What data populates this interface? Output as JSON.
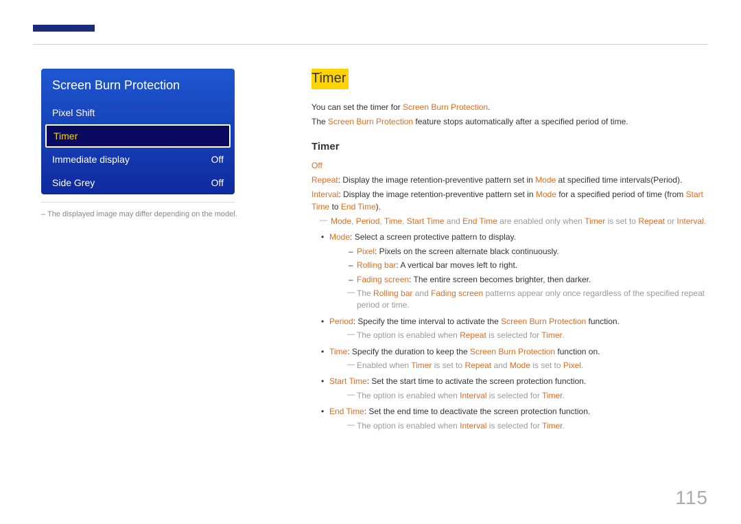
{
  "page_number": "115",
  "menu": {
    "title": "Screen Burn Protection",
    "items": [
      {
        "label": "Pixel Shift",
        "value": ""
      },
      {
        "label": "Timer",
        "value": ""
      },
      {
        "label": "Immediate display",
        "value": "Off"
      },
      {
        "label": "Side Grey",
        "value": "Off"
      }
    ]
  },
  "caption": "– The displayed image may differ depending on the model.",
  "section": {
    "title": "Timer",
    "intro1_a": "You can set the timer for ",
    "intro1_b": "Screen Burn Protection",
    "intro1_c": ".",
    "intro2_a": "The ",
    "intro2_b": "Screen Burn Protection",
    "intro2_c": " feature stops automatically after a specified period of time.",
    "sub_title": "Timer",
    "off": "Off",
    "repeat_a": "Repeat",
    "repeat_b": ": Display the image retention-preventive pattern set in ",
    "repeat_c": "Mode",
    "repeat_d": " at specified time intervals(Period).",
    "interval_a": "Interval",
    "interval_b": ": Display the image retention-preventive pattern set in ",
    "interval_c": "Mode",
    "interval_d": " for a specified period of time (from ",
    "interval_e": "Start Time",
    "interval_f": " to ",
    "interval_g": "End Time",
    "interval_h": ").",
    "note1": {
      "mode": "Mode",
      "comma1": ", ",
      "period": "Period",
      "comma2": ", ",
      "time": "Time",
      "comma3": ", ",
      "start": "Start Time",
      "and": " and ",
      "end": "End Time",
      "txt": " are enabled only when ",
      "timer": "Timer",
      "set": " is set to ",
      "repeat": "Repeat",
      "or": " or ",
      "interval": "Interval",
      "dot": "."
    },
    "mode_li_a": "Mode",
    "mode_li_b": ": Select a screen protective pattern to display.",
    "pixel_a": "Pixel",
    "pixel_b": ": Pixels on the screen alternate black continuously.",
    "rolling_a": "Rolling bar",
    "rolling_b": ": A vertical bar moves left to right.",
    "fading_a": "Fading screen",
    "fading_b": ": The entire screen becomes brighter, then darker.",
    "note2_a": "The ",
    "note2_b": "Rolling bar",
    "note2_c": " and ",
    "note2_d": "Fading screen",
    "note2_e": " patterns appear only once regardless of the specified repeat period or time.",
    "period_li_a": "Period",
    "period_li_b": ": Specify the time interval to activate the ",
    "period_li_c": "Screen Burn Protection",
    "period_li_d": " function.",
    "note3_a": "The option is enabled when ",
    "note3_b": "Repeat",
    "note3_c": " is selected for ",
    "note3_d": "Timer",
    "note3_e": ".",
    "time_li_a": "Time",
    "time_li_b": ": Specify the duration to keep the ",
    "time_li_c": "Screen Burn Protection",
    "time_li_d": " function on.",
    "note4_a": "Enabled when ",
    "note4_b": "Timer",
    "note4_c": " is set to ",
    "note4_d": "Repeat",
    "note4_e": " and ",
    "note4_f": "Mode",
    "note4_g": " is set to ",
    "note4_h": "Pixel",
    "note4_i": ".",
    "start_li_a": "Start Time",
    "start_li_b": ": Set the start time to activate the screen protection function.",
    "note5_a": "The option is enabled when ",
    "note5_b": "Interval",
    "note5_c": " is selected for ",
    "note5_d": "Timer",
    "note5_e": ".",
    "end_li_a": "End Time",
    "end_li_b": ": Set the end time to deactivate the screen protection function.",
    "note6_a": "The option is enabled when ",
    "note6_b": "Interval",
    "note6_c": " is selected for ",
    "note6_d": "Timer",
    "note6_e": "."
  }
}
